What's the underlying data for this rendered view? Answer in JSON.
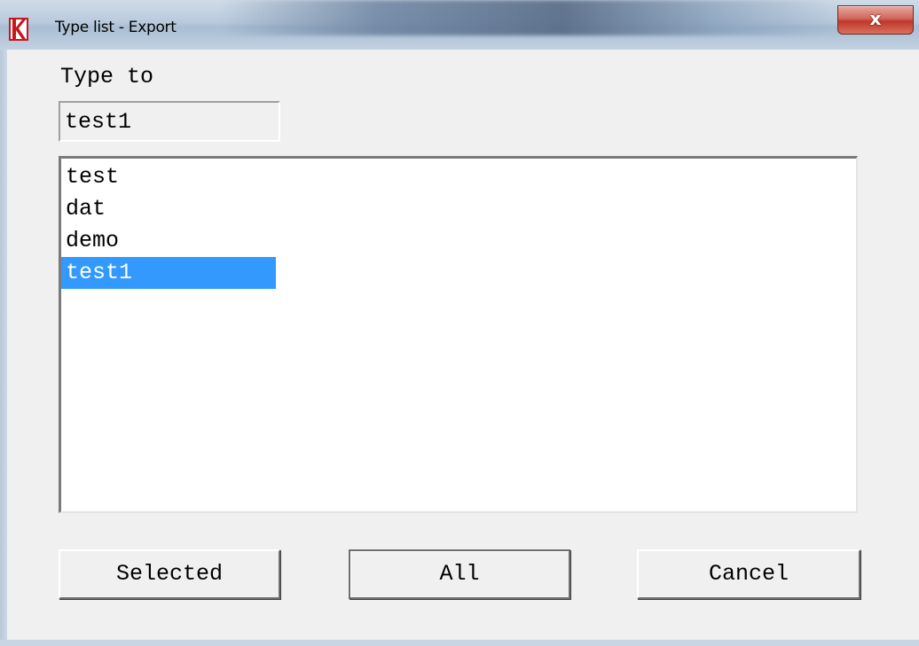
{
  "window": {
    "title": "Type list - Export",
    "app_icon": "red-k-logo-icon",
    "close_icon": "close-x-icon",
    "close_label": "x"
  },
  "form": {
    "type_to_label": "Type to",
    "type_to_value": "test1"
  },
  "list": {
    "items": [
      "test",
      "dat",
      "demo",
      "test1"
    ],
    "selected_index": 3
  },
  "buttons": {
    "selected_label": "Selected",
    "all_label": "All",
    "cancel_label": "Cancel"
  },
  "colors": {
    "selection_bg": "#3399ff",
    "selection_fg": "#ffffff",
    "close_button": "#c0382a",
    "dialog_bg": "#f0f0f0"
  }
}
